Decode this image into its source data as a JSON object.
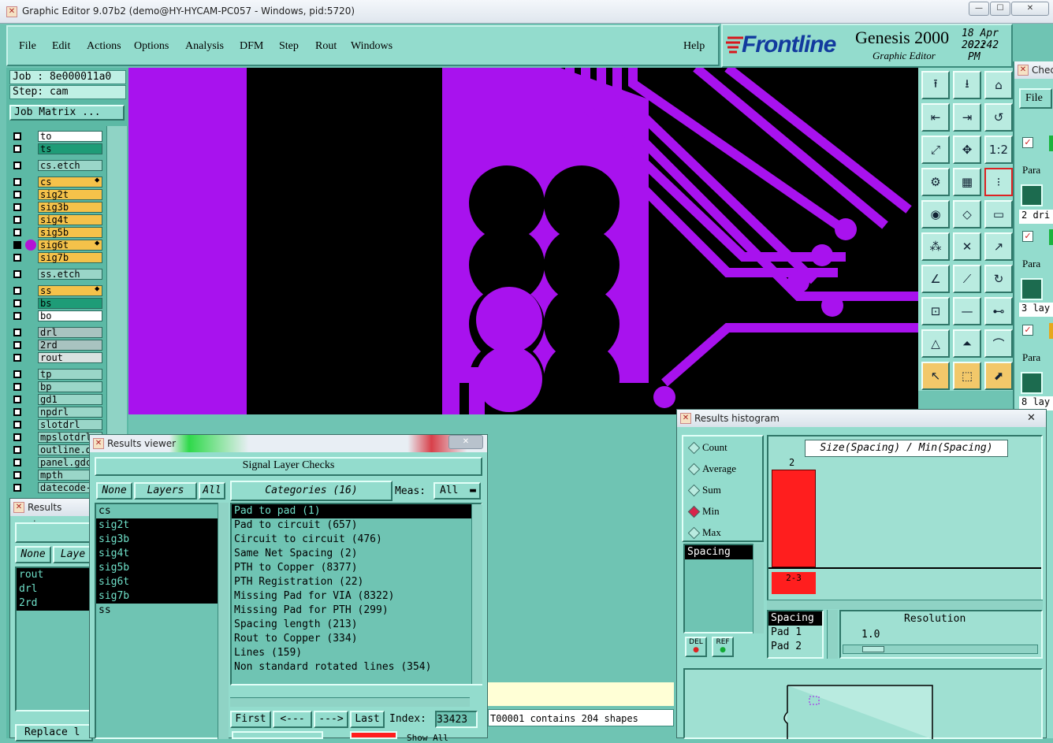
{
  "window": {
    "title": "Graphic Editor 9.07b2 (demo@HY-HYCAM-PC057 - Windows, pid:5720)",
    "minimize": "—",
    "maximize": "☐",
    "close": "✕"
  },
  "menu": {
    "items": [
      "File",
      "Edit",
      "Actions",
      "Options",
      "Analysis",
      "DFM",
      "Step",
      "Rout",
      "Windows"
    ],
    "help": "Help"
  },
  "brand": {
    "logo": "Frontline",
    "product": "Genesis 2000",
    "subtitle": "Graphic Editor",
    "date": "18 Apr 2022",
    "time": "02:42 PM"
  },
  "job": {
    "job_label": "Job : 8e000011a0",
    "step_label": "Step: cam",
    "matrix_button": "Job Matrix ..."
  },
  "layers": [
    {
      "name": "to",
      "color": "#ffffff"
    },
    {
      "name": "ts",
      "color": "#1e9c77"
    },
    {
      "name": "cs.etch",
      "color": "#9ad6c8"
    },
    {
      "name": "cs",
      "color": "#f5c24a"
    },
    {
      "name": "sig2t",
      "color": "#f5c24a"
    },
    {
      "name": "sig3b",
      "color": "#f5c24a"
    },
    {
      "name": "sig4t",
      "color": "#f5c24a"
    },
    {
      "name": "sig5b",
      "color": "#f5c24a"
    },
    {
      "name": "sig6t",
      "color": "#f5c24a"
    },
    {
      "name": "sig7b",
      "color": "#f5c24a"
    },
    {
      "name": "ss.etch",
      "color": "#9ad6c8"
    },
    {
      "name": "ss",
      "color": "#f5c24a"
    },
    {
      "name": "bs",
      "color": "#1e9c77"
    },
    {
      "name": "bo",
      "color": "#ffffff"
    },
    {
      "name": "drl",
      "color": "#a9c3c0"
    },
    {
      "name": "2rd",
      "color": "#a9c3c0"
    },
    {
      "name": "rout",
      "color": "#d9e2e0"
    },
    {
      "name": "tp",
      "color": "#9ad6c8"
    },
    {
      "name": "bp",
      "color": "#9ad6c8"
    },
    {
      "name": "gd1",
      "color": "#9ad6c8"
    },
    {
      "name": "npdrl",
      "color": "#9ad6c8"
    },
    {
      "name": "slotdrl",
      "color": "#9ad6c8"
    },
    {
      "name": "mpslotdrl",
      "color": "#9ad6c8"
    },
    {
      "name": "outline.d",
      "color": "#9ad6c8"
    },
    {
      "name": "panel.gdc",
      "color": "#9ad6c8"
    },
    {
      "name": "mpth",
      "color": "#9ad6c8"
    },
    {
      "name": "datecode-",
      "color": "#9ad6c8"
    }
  ],
  "results_viewer_back": {
    "title": "Results viewer",
    "none": "None",
    "layers": "Laye",
    "items": [
      "rout",
      "drl",
      "2rd"
    ],
    "replace": "Replace l"
  },
  "results_viewer": {
    "title": "Results viewer",
    "header": "Signal Layer Checks",
    "none": "None",
    "layers": "Layers",
    "all": "All",
    "categories": "Categories (16)",
    "meas_label": "Meas:",
    "meas_value": "All",
    "layer_list": [
      "cs",
      "sig2t",
      "sig3b",
      "sig4t",
      "sig5b",
      "sig6t",
      "sig7b",
      "ss"
    ],
    "category_list": [
      "Pad to pad (1)",
      "Pad to circuit (657)",
      "Circuit to circuit (476)",
      "Same Net Spacing (2)",
      "PTH to Copper (8377)",
      "PTH Registration (22)",
      "Missing Pad for VIA (8322)",
      "Missing Pad for PTH (299)",
      "Spacing length (213)",
      "Rout to Copper (334)",
      "Lines (159)",
      "Non standard rotated lines (354)"
    ],
    "first": "First",
    "prev": "<---",
    "next": "--->",
    "last": "Last",
    "index_label": "Index:",
    "index_value": "33423",
    "show_all": "Show All"
  },
  "status_text": "T00001 contains 204 shapes",
  "histogram": {
    "title": "Results histogram",
    "modes": [
      "Count",
      "Average",
      "Sum",
      "Min",
      "Max"
    ],
    "selected_mode": "Min",
    "list_item": "Spacing",
    "chart_title": "Size(Spacing) / Min(Spacing)",
    "bar_top_label": "2",
    "bar_range_label": "2-3",
    "del": "DEL",
    "ref": "REF",
    "attr_items": [
      "Spacing",
      "Pad 1",
      "Pad 2"
    ],
    "resolution_label": "Resolution",
    "resolution_value": "1.0",
    "bar_color": "#ff1e1e"
  },
  "check_win": {
    "title": "Chec",
    "file": "File",
    "para": "Para",
    "rows": [
      "2 dri",
      "3 lay",
      "8 lay"
    ]
  },
  "colors": {
    "magenta": "#a812ee",
    "panel": "#93dccd",
    "dark_teal": "#3b8a7c"
  }
}
